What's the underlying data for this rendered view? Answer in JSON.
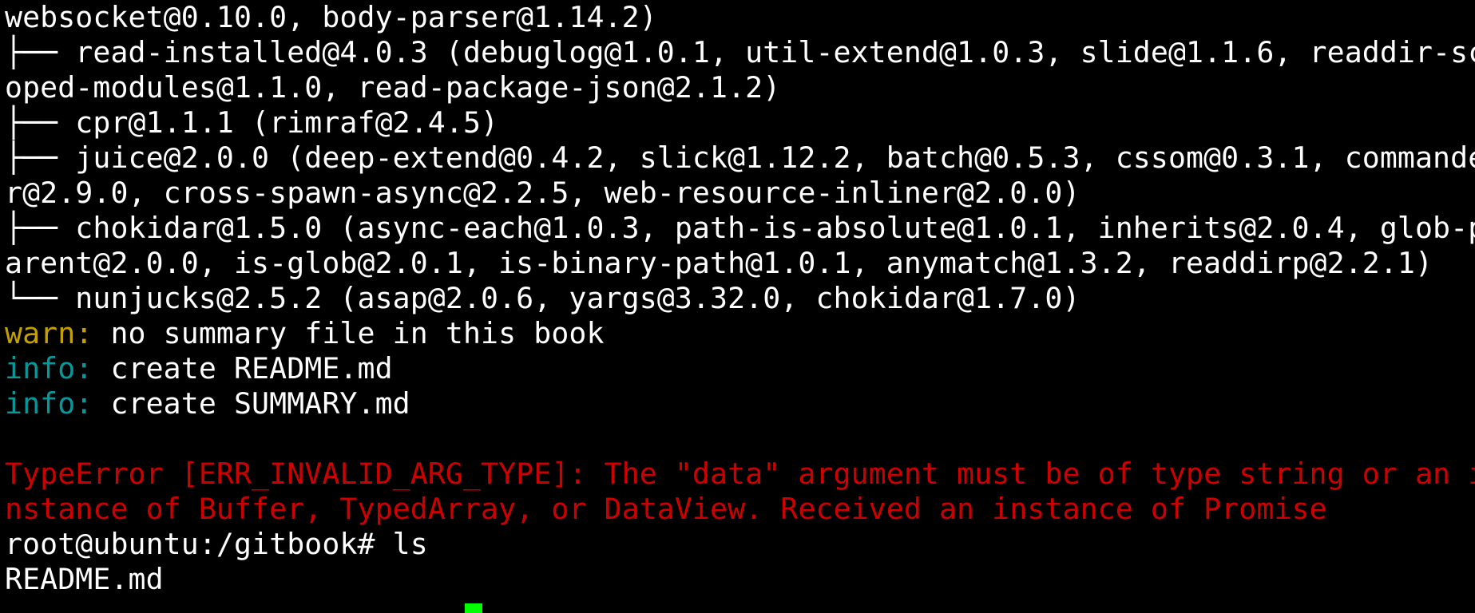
{
  "terminal": {
    "lines": [
      {
        "segments": [
          {
            "text": "websocket@0.10.0, body-parser@1.14.2)",
            "style": "default"
          }
        ]
      },
      {
        "segments": [
          {
            "text": "├── read-installed@4.0.3 (debuglog@1.0.1, util-extend@1.0.3, slide@1.1.6, readdir-sc",
            "style": "default"
          }
        ]
      },
      {
        "segments": [
          {
            "text": "oped-modules@1.1.0, read-package-json@2.1.2)",
            "style": "default"
          }
        ]
      },
      {
        "segments": [
          {
            "text": "├── cpr@1.1.1 (rimraf@2.4.5)",
            "style": "default"
          }
        ]
      },
      {
        "segments": [
          {
            "text": "├── juice@2.0.0 (deep-extend@0.4.2, slick@1.12.2, batch@0.5.3, cssom@0.3.1, commande",
            "style": "default"
          }
        ]
      },
      {
        "segments": [
          {
            "text": "r@2.9.0, cross-spawn-async@2.2.5, web-resource-inliner@2.0.0)",
            "style": "default"
          }
        ]
      },
      {
        "segments": [
          {
            "text": "├── chokidar@1.5.0 (async-each@1.0.3, path-is-absolute@1.0.1, inherits@2.0.4, glob-p",
            "style": "default"
          }
        ]
      },
      {
        "segments": [
          {
            "text": "arent@2.0.0, is-glob@2.0.1, is-binary-path@1.0.1, anymatch@1.3.2, readdirp@2.2.1)",
            "style": "default"
          }
        ]
      },
      {
        "segments": [
          {
            "text": "└── nunjucks@2.5.2 (asap@2.0.6, yargs@3.32.0, chokidar@1.7.0)",
            "style": "default"
          }
        ]
      },
      {
        "segments": [
          {
            "text": "warn:",
            "style": "warn"
          },
          {
            "text": " no summary file in this book",
            "style": "default"
          }
        ]
      },
      {
        "segments": [
          {
            "text": "info:",
            "style": "info"
          },
          {
            "text": " create README.md",
            "style": "default"
          }
        ]
      },
      {
        "segments": [
          {
            "text": "info:",
            "style": "info"
          },
          {
            "text": " create SUMMARY.md",
            "style": "default"
          }
        ]
      },
      {
        "segments": [
          {
            "text": "",
            "style": "default"
          }
        ]
      },
      {
        "segments": [
          {
            "text": "TypeError [ERR_INVALID_ARG_TYPE]: The \"data\" argument must be of type string or an i",
            "style": "error"
          }
        ]
      },
      {
        "segments": [
          {
            "text": "nstance of Buffer, TypedArray, or DataView. Received an instance of Promise",
            "style": "error"
          }
        ]
      },
      {
        "segments": [
          {
            "text": "root@ubuntu:/gitbook# ls",
            "style": "default"
          }
        ]
      },
      {
        "segments": [
          {
            "text": "README.md",
            "style": "default"
          }
        ]
      }
    ],
    "colors": {
      "background": "#000000",
      "foreground": "#ffffff",
      "warn": "#c4a000",
      "info": "#06989a",
      "error": "#cc0000",
      "cursor": "#00ff00"
    }
  }
}
